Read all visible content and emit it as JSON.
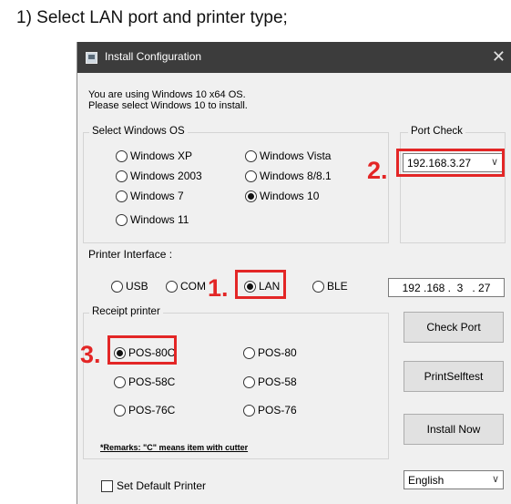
{
  "caption": "1) Select LAN port and printer type;",
  "window": {
    "title": "Install Configuration",
    "close_glyph": "✕",
    "info_line1": "You are using Windows 10 x64 OS.",
    "info_line2": "Please select Windows 10 to install."
  },
  "os_group": {
    "legend": "Select Windows OS",
    "options": [
      {
        "label": "Windows XP",
        "selected": false
      },
      {
        "label": "Windows Vista",
        "selected": false
      },
      {
        "label": "Windows 2003",
        "selected": false
      },
      {
        "label": "Windows 8/8.1",
        "selected": false
      },
      {
        "label": "Windows 7",
        "selected": false
      },
      {
        "label": "Windows 10",
        "selected": true
      },
      {
        "label": "Windows 11",
        "selected": false
      }
    ]
  },
  "port_check": {
    "legend": "Port Check",
    "selected_port": "192.168.3.27"
  },
  "printer_interface": {
    "label": "Printer Interface :",
    "options": [
      {
        "label": "USB",
        "selected": false
      },
      {
        "label": "COM",
        "selected": false
      },
      {
        "label": "LAN",
        "selected": true
      },
      {
        "label": "BLE",
        "selected": false
      }
    ],
    "ip_value": "192 .168 .  3   . 27"
  },
  "receipt_printer": {
    "legend": "Receipt printer",
    "options": [
      {
        "label": "POS-80C",
        "selected": true
      },
      {
        "label": "POS-80",
        "selected": false
      },
      {
        "label": "POS-58C",
        "selected": false
      },
      {
        "label": "POS-58",
        "selected": false
      },
      {
        "label": "POS-76C",
        "selected": false
      },
      {
        "label": "POS-76",
        "selected": false
      }
    ],
    "remark": "*Remarks: \"C\" means item with cutter"
  },
  "buttons": {
    "check_port": "Check Port",
    "print_selftest": "PrintSelftest",
    "install_now": "Install Now"
  },
  "default_printer": {
    "label": "Set Default Printer",
    "checked": false
  },
  "language": {
    "selected": "English"
  },
  "annotations": {
    "step1": "1.",
    "step2": "2.",
    "step3": "3.",
    "highlight_color": "#e32626"
  },
  "chevron_glyph": "∨"
}
